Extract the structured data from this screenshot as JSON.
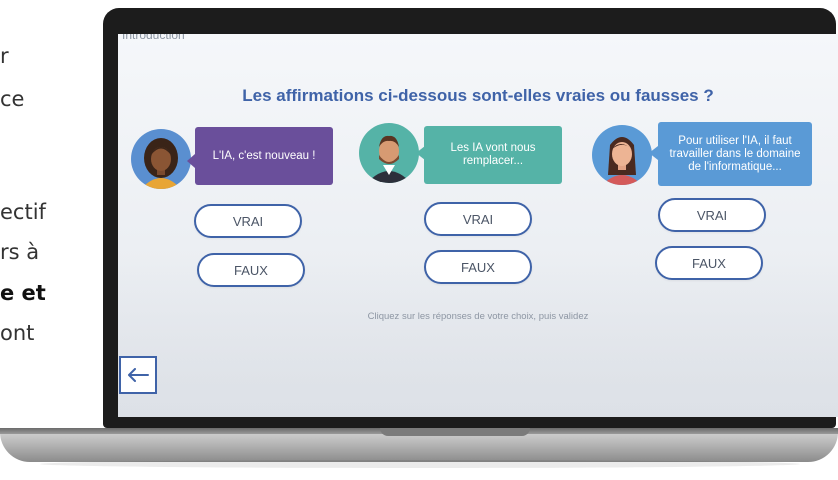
{
  "background_fragments": [
    "r",
    "ce",
    "ectif",
    "rs à",
    "e et",
    "ont"
  ],
  "screen": {
    "breadcrumb": "Introduction",
    "title": "Les affirmations ci-dessous sont-elles vraies ou fausses ?",
    "statements": [
      {
        "text": "L'IA, c'est nouveau !",
        "color": "#6a4f9b",
        "true_label": "VRAI",
        "false_label": "FAUX"
      },
      {
        "text": "Les IA vont nous remplacer...",
        "color": "#55b3a7",
        "true_label": "VRAI",
        "false_label": "FAUX"
      },
      {
        "text": "Pour utiliser l'IA, il faut travailler dans le domaine de l'informatique...",
        "color": "#5a9ad6",
        "true_label": "VRAI",
        "false_label": "FAUX"
      }
    ],
    "instruction": "Cliquez sur les réponses de votre choix, puis validez",
    "back_icon": "arrow-left-icon"
  },
  "colors": {
    "primary": "#3f63a8",
    "frame": "#1c1c1c"
  }
}
